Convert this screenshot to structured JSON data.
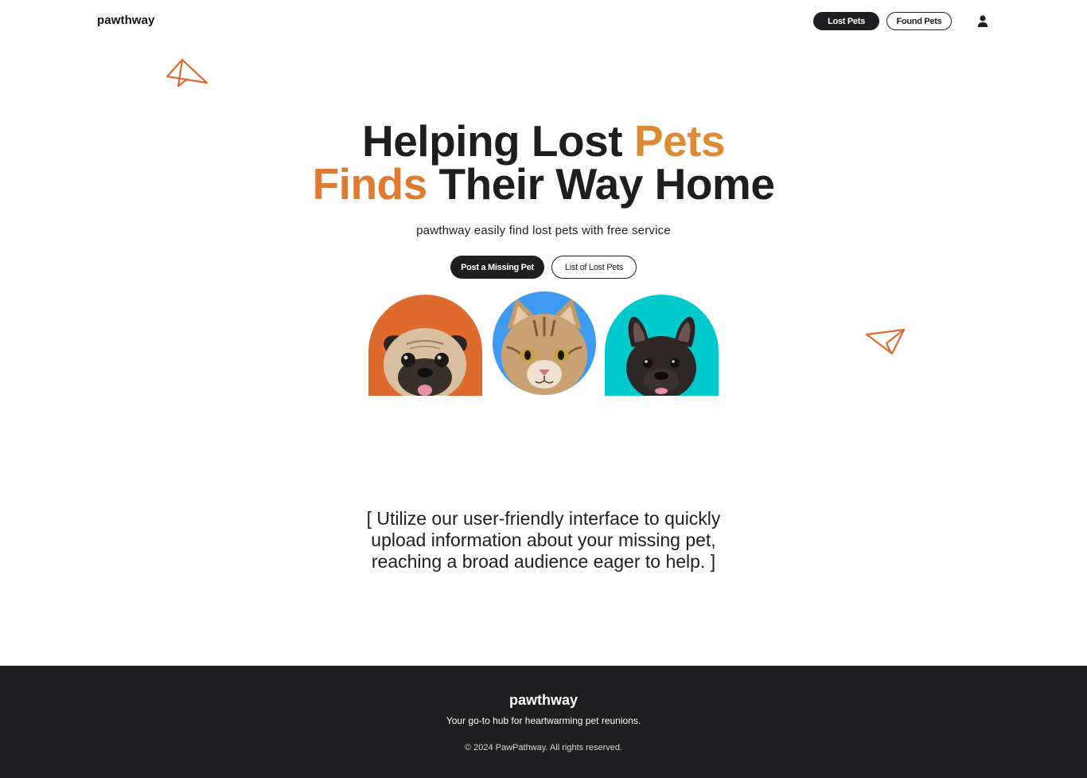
{
  "header": {
    "logo": "pawthway",
    "nav": {
      "lost_pets": "Lost Pets",
      "found_pets": "Found Pets"
    },
    "user_icon": "user-icon"
  },
  "hero": {
    "title_line1_dark": "Helping Lost ",
    "title_line1_accent": "Pets",
    "title_line2_accent": "Finds",
    "title_line2_dark": " Their Way Home",
    "subtitle": "pawthway easily find lost pets with free service",
    "buttons": {
      "post": "Post a Missing Pet",
      "list": "List of Lost Pets"
    },
    "pets": [
      {
        "animal": "pug",
        "bg": "#df6a2e"
      },
      {
        "animal": "cat",
        "bg": "#3d9af0"
      },
      {
        "animal": "french-bulldog",
        "bg": "#00c9cc"
      }
    ]
  },
  "feature": {
    "text": "[ Utilize our user-friendly interface to quickly upload information about your missing pet, reaching a broad audience eager to help. ]"
  },
  "footer": {
    "logo": "pawthway",
    "tagline": "Your go-to hub for heartwarming pet reunions.",
    "copyright": "© 2024 PawPathway. All rights reserved."
  },
  "colors": {
    "dark": "#1e1e20",
    "accent_orange": "#e0682a",
    "accent_gold": "#dc9a3a"
  }
}
